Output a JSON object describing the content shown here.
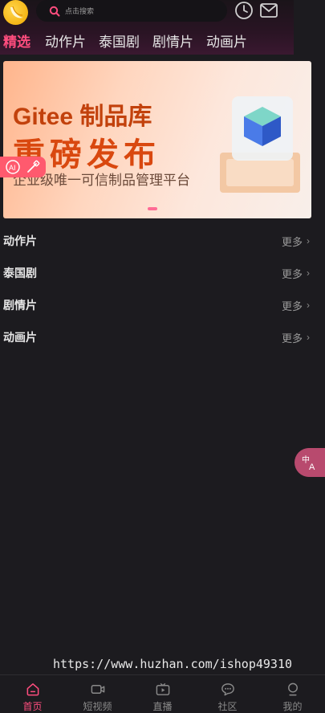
{
  "header": {
    "logo": "banana-logo-icon",
    "search_placeholder": "点击搜索",
    "history_icon": "clock-icon",
    "mail_icon": "mail-icon"
  },
  "tabs": [
    {
      "label": "精选",
      "active": true
    },
    {
      "label": "动作片",
      "active": false
    },
    {
      "label": "泰国剧",
      "active": false
    },
    {
      "label": "剧情片",
      "active": false
    },
    {
      "label": "动画片",
      "active": false
    }
  ],
  "banner": {
    "line1": "Gitee 制品库",
    "line2": "重磅发布",
    "line3": "企业级唯一可信制品管理平台",
    "slide_index": 1
  },
  "sections": [
    {
      "title": "动作片",
      "more": "更多"
    },
    {
      "title": "泰国剧",
      "more": "更多"
    },
    {
      "title": "剧情片",
      "more": "更多"
    },
    {
      "title": "动画片",
      "more": "更多"
    }
  ],
  "watermark": "https://www.huzhan.com/ishop49310",
  "bottom_nav": [
    {
      "label": "首页",
      "icon": "home-icon",
      "active": true
    },
    {
      "label": "短视频",
      "icon": "video-camera-icon",
      "active": false
    },
    {
      "label": "直播",
      "icon": "tv-play-icon",
      "active": false
    },
    {
      "label": "社区",
      "icon": "chat-bubble-icon",
      "active": false
    },
    {
      "label": "我的",
      "icon": "user-icon",
      "active": false
    }
  ],
  "colors": {
    "accent": "#ff4d7e",
    "background": "#1c1b1f"
  }
}
